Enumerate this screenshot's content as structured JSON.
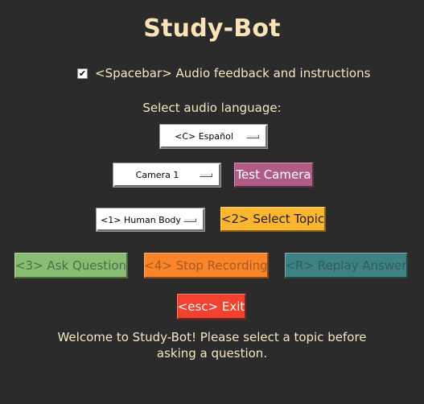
{
  "app": {
    "title": "Study-Bot"
  },
  "audio_feedback": {
    "checked": true,
    "check_mark": "✔",
    "label": "<Spacebar> Audio feedback and instructions"
  },
  "language": {
    "label": "Select audio language:",
    "selected": "<C> Español"
  },
  "camera": {
    "selected": "Camera 1",
    "test_button_label": "Test Camera",
    "test_button_color": "#b05c86"
  },
  "topic": {
    "selected": "<1> Human Body",
    "select_button_label": "<2> Select Topic",
    "select_button_color": "#fbb52f"
  },
  "actions": {
    "ask_label": "<3> Ask Question",
    "ask_color": "#88be74",
    "stop_label": "<4> Stop Recording",
    "stop_color": "#f98429",
    "replay_label": "<R> Replay Answer",
    "replay_color": "#3f8284",
    "exit_label": "<esc> Exit",
    "exit_color": "#f3412f"
  },
  "status": {
    "line1": "Welcome to Study-Bot! Please select a topic before",
    "line2": "asking a question."
  }
}
